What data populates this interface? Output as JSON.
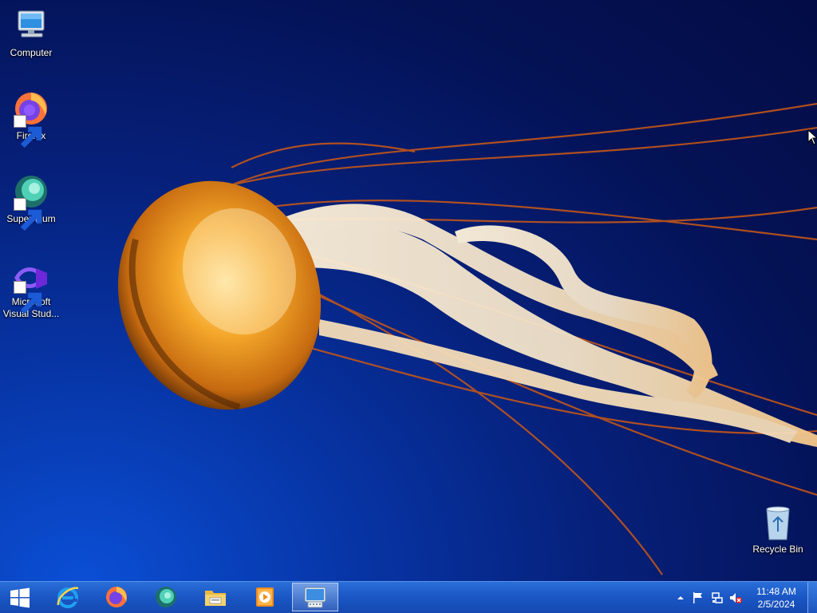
{
  "desktop": {
    "icons": [
      {
        "label": "Computer"
      },
      {
        "label": "Firefox"
      },
      {
        "label": "Supermium"
      },
      {
        "label": "Microsoft Visual Stud..."
      },
      {
        "label": "Recycle Bin"
      }
    ]
  },
  "taskbar": {
    "start_icon": "windows-start-icon",
    "pinned": [
      {
        "name": "internet-explorer-icon"
      },
      {
        "name": "firefox-icon"
      },
      {
        "name": "supermium-icon"
      },
      {
        "name": "file-explorer-icon"
      },
      {
        "name": "media-player-icon"
      },
      {
        "name": "on-screen-keyboard-icon",
        "active": true
      }
    ],
    "tray": {
      "icons": [
        "show-hidden-icons-arrow",
        "action-center-flag-icon",
        "network-icon",
        "volume-muted-icon"
      ],
      "time": "11:48 AM",
      "date": "2/5/2024"
    }
  },
  "colors": {
    "taskbar": "#1a56c4",
    "desktop_bg": "#041256",
    "jellyfish": "#e08a1a"
  }
}
